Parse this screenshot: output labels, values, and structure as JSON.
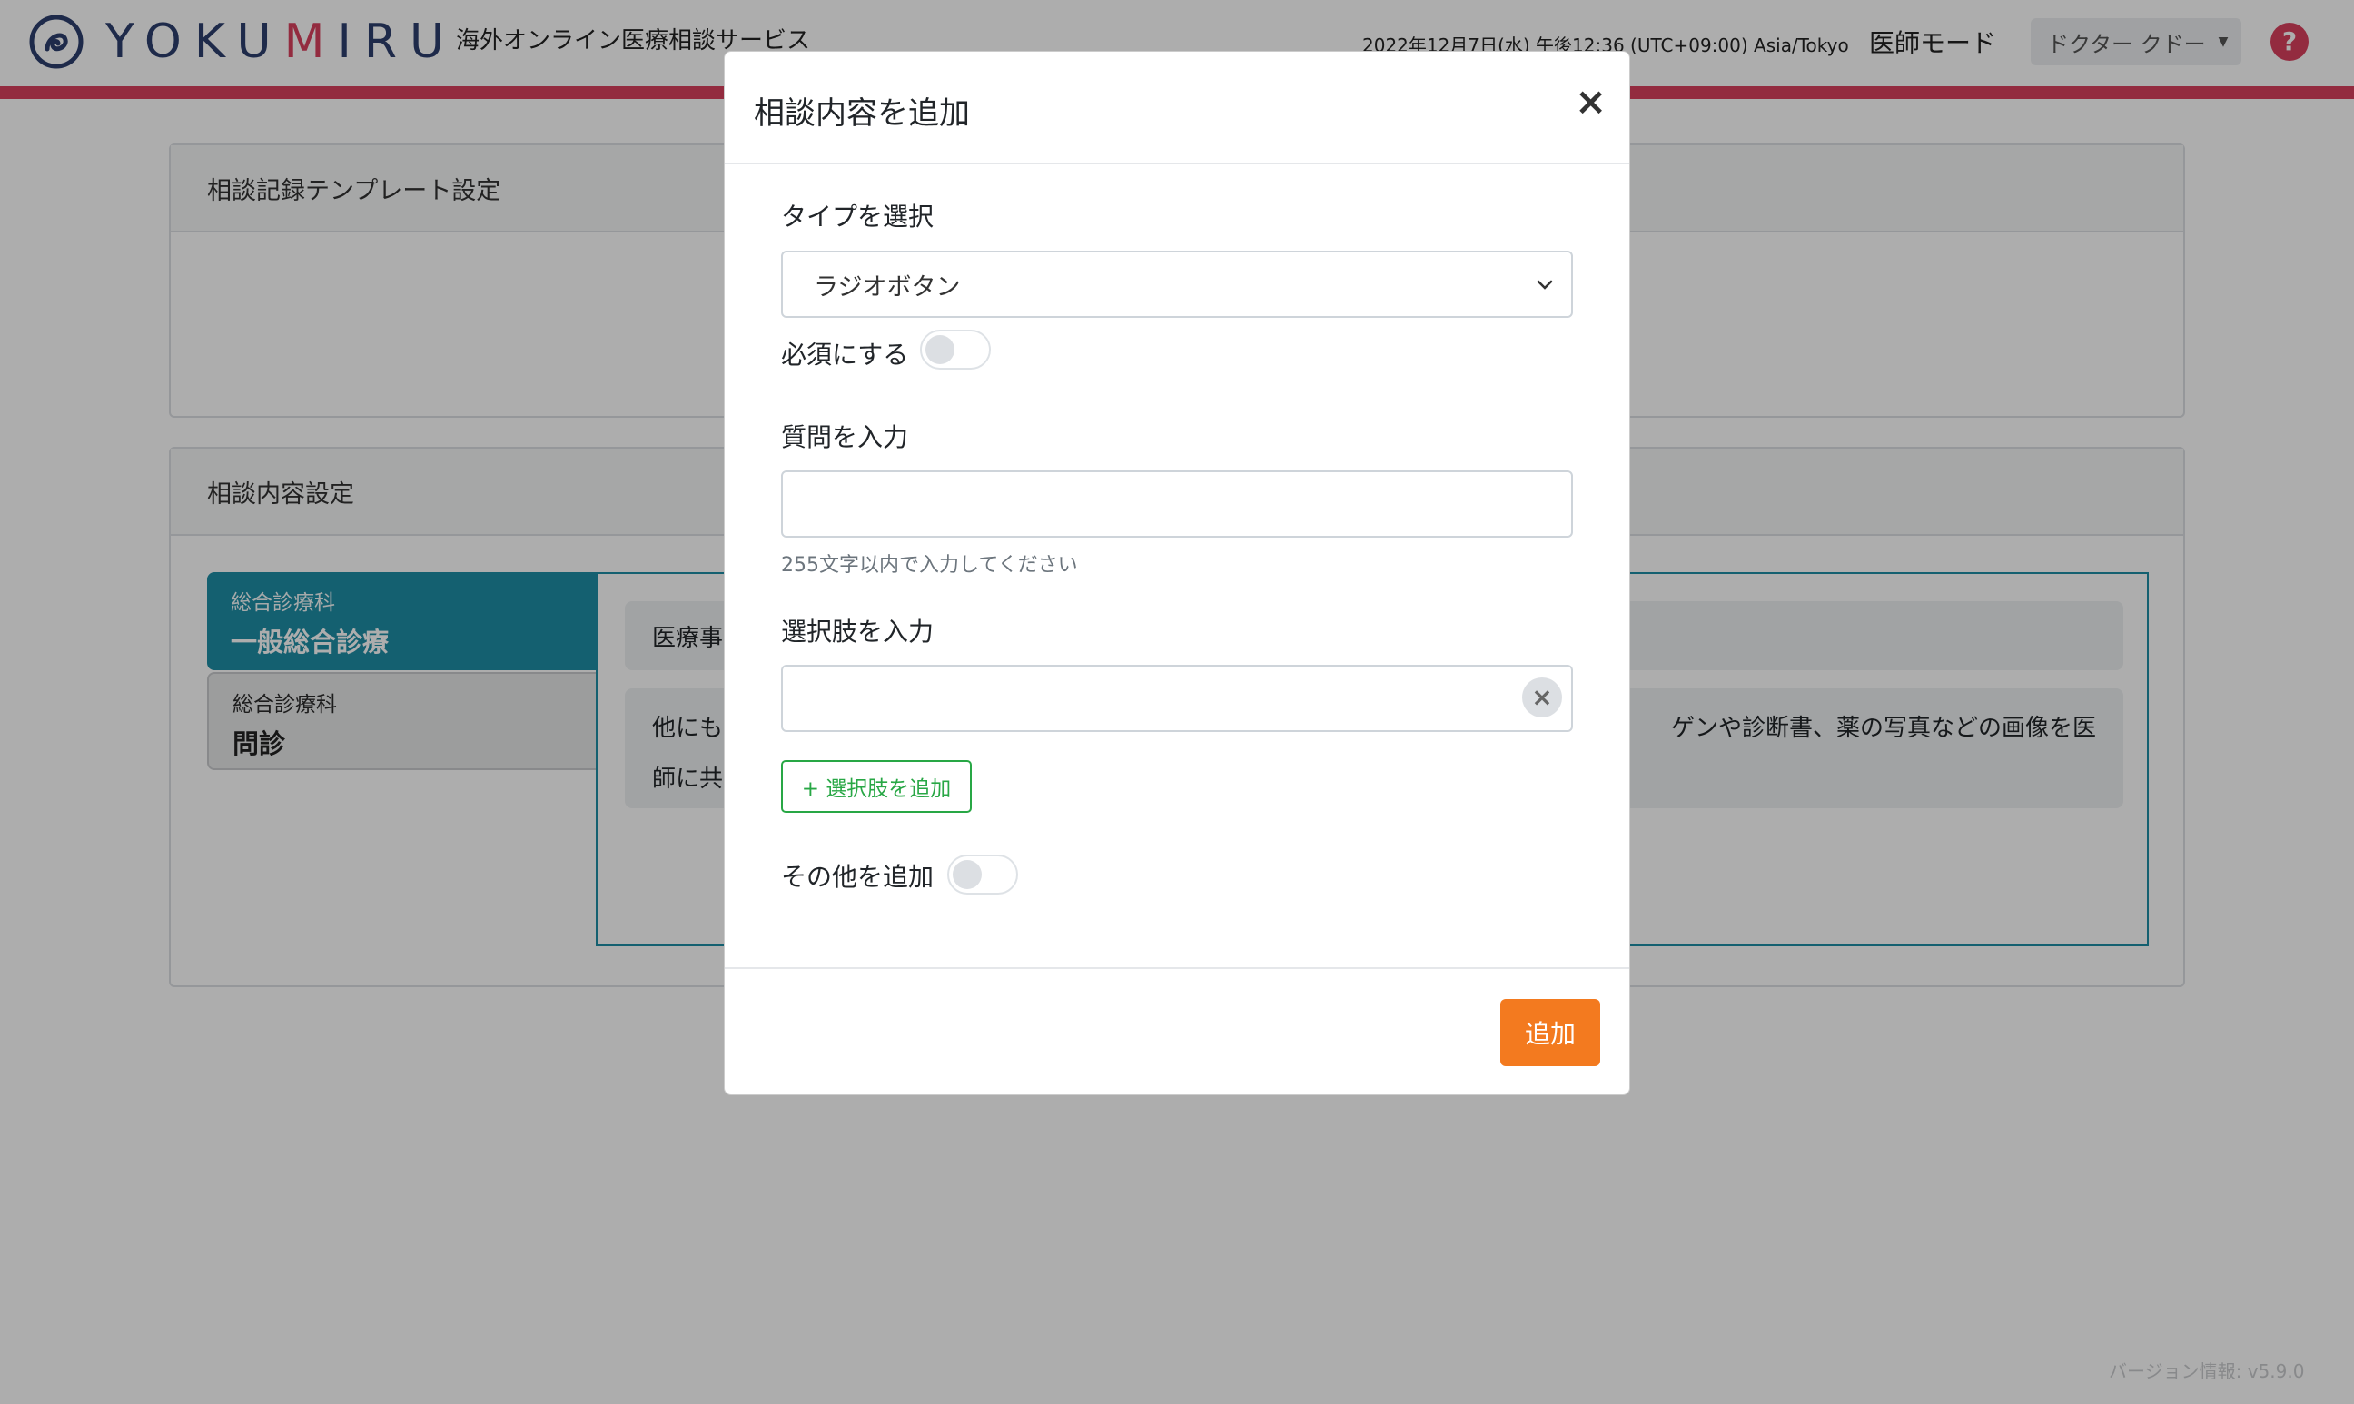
{
  "header": {
    "logo_prefix": "YOKU",
    "logo_heart": "M",
    "logo_suffix": "IRU",
    "service_name": "海外オンライン医療相談サービス",
    "datetime": "2022年12月7日(水) 午後12:36 (UTC+09:00) Asia/Tokyo",
    "mode_label": "医師モード",
    "user_name": "ドクター クドー",
    "help_label": "?"
  },
  "cards": {
    "template_settings_title": "相談記録テンプレート設定",
    "content_settings_title": "相談内容設定"
  },
  "departments": [
    {
      "category": "総合診療科",
      "name": "一般総合診療"
    },
    {
      "category": "総合診療科",
      "name": "問診"
    }
  ],
  "panel": {
    "box1_text": "医療事",
    "box2_line1_left": "他にも",
    "box2_line1_right": "ゲンや診断書、薬の写真などの画像を医",
    "box2_line2_left": "師に共"
  },
  "version": "バージョン情報: v5.9.0",
  "modal": {
    "title": "相談内容を追加",
    "close_label": "×",
    "type_label": "タイプを選択",
    "type_value": "ラジオボタン",
    "required_label": "必須にする",
    "question_label": "質問を入力",
    "question_value": "",
    "question_help": "255文字以内で入力してください",
    "choices_label": "選択肢を入力",
    "choice_value": "",
    "clear_label": "×",
    "add_choice_label": "+ 選択肢を追加",
    "other_label": "その他を追加",
    "submit_label": "追加"
  },
  "colors": {
    "brand_navy": "#2d3e6e",
    "brand_pink": "#d9405e",
    "accent_teal": "#1e8ea6",
    "submit_orange": "#f37a1f",
    "outline_green": "#28a745"
  }
}
